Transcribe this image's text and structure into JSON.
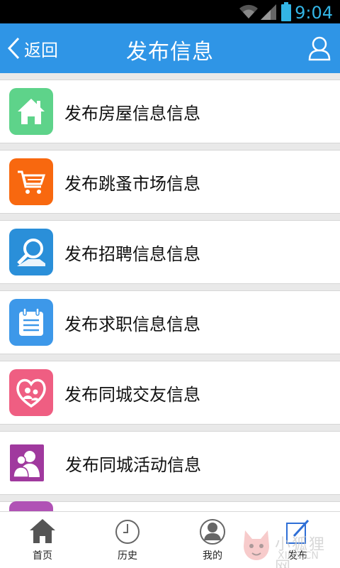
{
  "status_bar": {
    "time": "9:04"
  },
  "header": {
    "back_label": "返回",
    "title": "发布信息"
  },
  "list": {
    "items": [
      {
        "label": "发布房屋信息信息",
        "icon": "house-icon",
        "color": "#5ed38a"
      },
      {
        "label": "发布跳蚤市场信息",
        "icon": "cart-icon",
        "color": "#f8680f"
      },
      {
        "label": "发布招聘信息信息",
        "icon": "magnifier-icon",
        "color": "#2a8fd9"
      },
      {
        "label": "发布求职信息信息",
        "icon": "calendar-icon",
        "color": "#3d98e9"
      },
      {
        "label": "发布同城交友信息",
        "icon": "heart-icon",
        "color": "#ef5e82"
      },
      {
        "label": "发布同城活动信息",
        "icon": "people-icon",
        "color": "#a0399e"
      }
    ]
  },
  "bottom_nav": {
    "items": [
      {
        "label": "首页",
        "icon": "home-icon"
      },
      {
        "label": "历史",
        "icon": "clock-icon"
      },
      {
        "label": "我的",
        "icon": "profile-icon"
      },
      {
        "label": "发布",
        "icon": "edit-icon"
      }
    ]
  },
  "watermark": {
    "text": "小狐狸网",
    "sub": "XIHS.CN"
  },
  "colors": {
    "header": "#2f95e6",
    "status_accent": "#33b5e5"
  }
}
